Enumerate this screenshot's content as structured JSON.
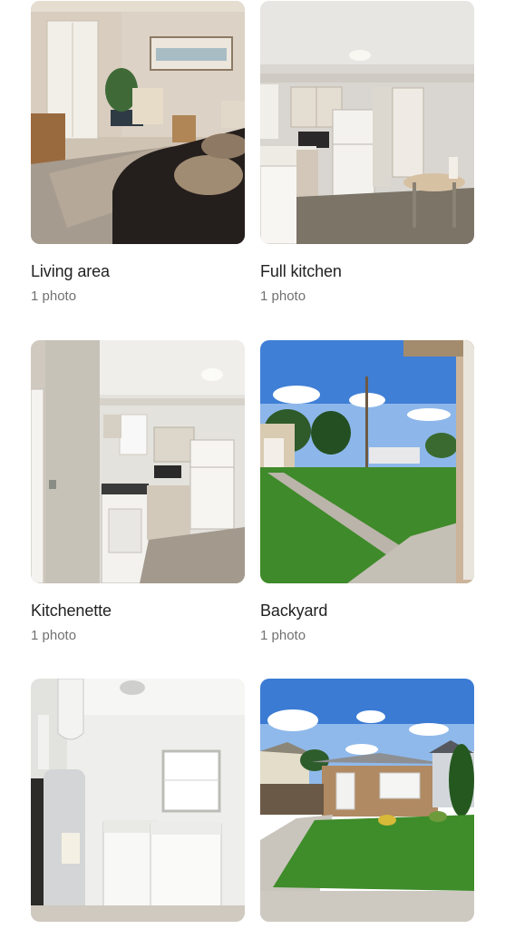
{
  "gallery": {
    "items": [
      {
        "title": "Living area",
        "count_label": "1 photo",
        "image": "living-room-photo"
      },
      {
        "title": "Full kitchen",
        "count_label": "1 photo",
        "image": "kitchen-photo"
      },
      {
        "title": "Kitchenette",
        "count_label": "1 photo",
        "image": "kitchenette-photo"
      },
      {
        "title": "Backyard",
        "count_label": "1 photo",
        "image": "backyard-photo"
      },
      {
        "title": "",
        "count_label": "",
        "image": "laundry-room-photo"
      },
      {
        "title": "",
        "count_label": "",
        "image": "house-exterior-photo"
      }
    ]
  }
}
